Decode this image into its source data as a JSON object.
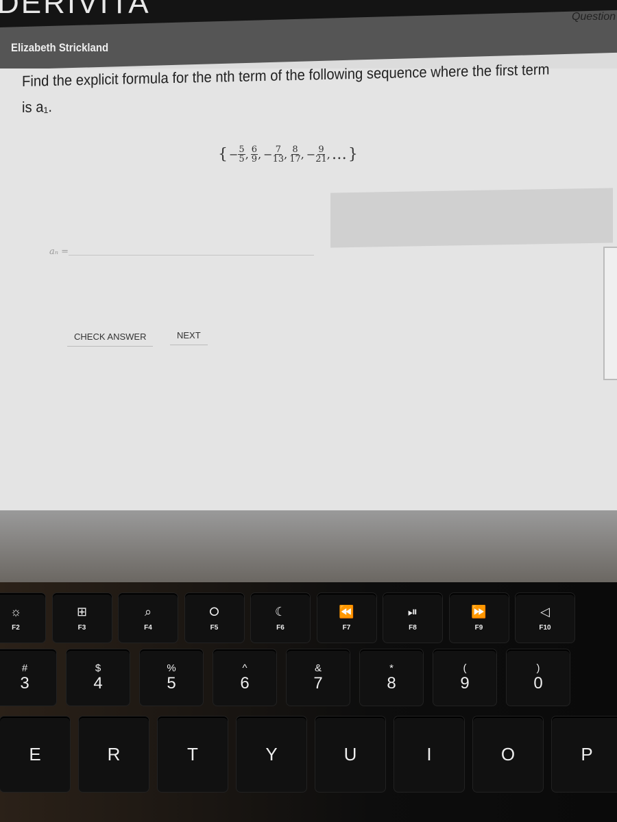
{
  "header": {
    "logo": "DERIVITA",
    "user": "Elizabeth Strickland",
    "question_label": "Question"
  },
  "question": {
    "prompt": "Find the explicit formula for the nth term of the following sequence where the first term is a₁.",
    "sequence": {
      "open": "{",
      "close": "}",
      "terms": [
        {
          "sign": "−",
          "num": "5",
          "den": "5"
        },
        {
          "sign": "",
          "num": "6",
          "den": "9"
        },
        {
          "sign": "−",
          "num": "7",
          "den": "13"
        },
        {
          "sign": "",
          "num": "8",
          "den": "17"
        },
        {
          "sign": "−",
          "num": "9",
          "den": "21"
        }
      ],
      "ellipsis": "…"
    },
    "answer_label": "aₙ =",
    "answer_value": ""
  },
  "buttons": {
    "check": "CHECK ANSWER",
    "next": "NEXT"
  },
  "keyboard": {
    "function_row": [
      {
        "icon": "☼",
        "label": "F2",
        "name": "brightness-icon"
      },
      {
        "icon": "⊞",
        "label": "F3",
        "name": "mission-control-icon"
      },
      {
        "icon": "⌕",
        "label": "F4",
        "name": "search-icon"
      },
      {
        "icon": "⭘",
        "label": "F5",
        "name": "microphone-icon"
      },
      {
        "icon": "☾",
        "label": "F6",
        "name": "moon-icon"
      },
      {
        "icon": "⏪",
        "label": "F7",
        "name": "rewind-icon"
      },
      {
        "icon": "⏯",
        "label": "F8",
        "name": "play-pause-icon"
      },
      {
        "icon": "⏩",
        "label": "F9",
        "name": "fast-forward-icon"
      },
      {
        "icon": "◁",
        "label": "F10",
        "name": "mute-icon"
      }
    ],
    "number_row": [
      {
        "shift": "#",
        "main": "3"
      },
      {
        "shift": "$",
        "main": "4"
      },
      {
        "shift": "%",
        "main": "5"
      },
      {
        "shift": "^",
        "main": "6"
      },
      {
        "shift": "&",
        "main": "7"
      },
      {
        "shift": "*",
        "main": "8"
      },
      {
        "shift": "(",
        "main": "9"
      },
      {
        "shift": ")",
        "main": "0"
      }
    ],
    "letter_row": [
      "E",
      "R",
      "T",
      "Y",
      "U",
      "I",
      "O",
      "P"
    ]
  }
}
